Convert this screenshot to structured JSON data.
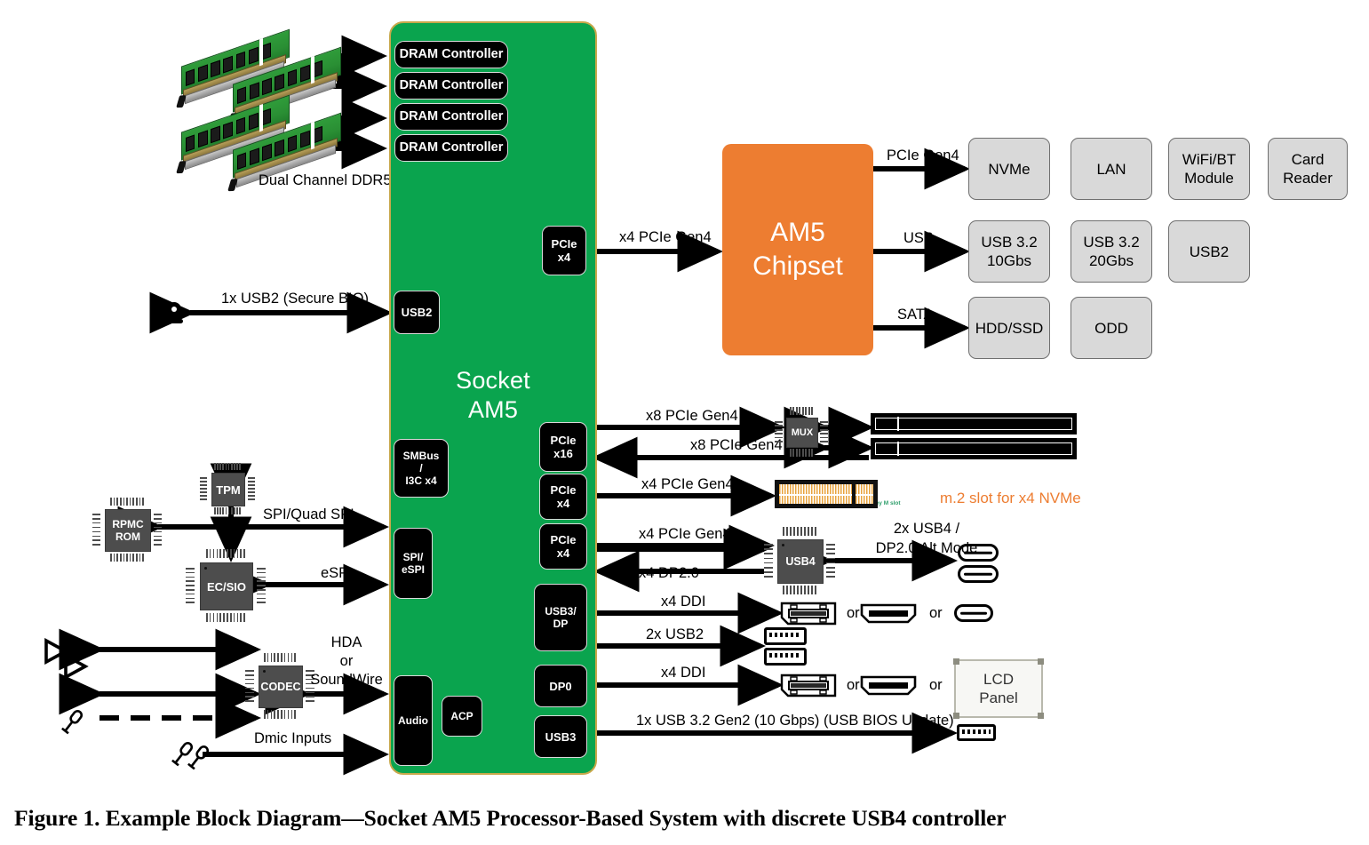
{
  "figure": {
    "caption": "Figure 1. Example Block Diagram—Socket AM5 Processor-Based System with discrete USB4 controller"
  },
  "colors": {
    "socket_green": "#0AA44E",
    "chipset_orange": "#ED7D31",
    "peripheral_grey": "#D9D9D9",
    "block_black": "#000000",
    "chip_grey": "#4D4D4D",
    "keym_green": "#2E9E6B"
  },
  "socket": {
    "title_line1": "Socket",
    "title_line2": "AM5",
    "dram_controllers": [
      {
        "label": "DRAM Controller"
      },
      {
        "label": "DRAM Controller"
      },
      {
        "label": "DRAM Controller"
      },
      {
        "label": "DRAM Controller"
      }
    ],
    "left_blocks": [
      {
        "name": "usb2",
        "label": "USB2"
      },
      {
        "name": "smbus",
        "label": "SMBus\n/\nI3C x4",
        "l1": "SMBus",
        "l2": "/",
        "l3": "I3C x4"
      },
      {
        "name": "spi-espi",
        "label": "SPI/\neSPI",
        "l1": "SPI/",
        "l2": "eSPI"
      },
      {
        "name": "audio",
        "label": "Audio"
      },
      {
        "name": "acp",
        "label": "ACP"
      }
    ],
    "right_blocks": [
      {
        "name": "pcie-x4-chipset",
        "l1": "PCIe",
        "l2": "x4"
      },
      {
        "name": "pcie-x16",
        "l1": "PCIe",
        "l2": "x16"
      },
      {
        "name": "pcie-x4-m2",
        "l1": "PCIe",
        "l2": "x4"
      },
      {
        "name": "pcie-x4-usb4",
        "l1": "PCIe",
        "l2": "x4"
      },
      {
        "name": "usb3-dp",
        "l1": "USB3/",
        "l2": "DP"
      },
      {
        "name": "dp0",
        "l1": "DP0",
        "l2": ""
      },
      {
        "name": "usb3",
        "l1": "USB3",
        "l2": ""
      }
    ]
  },
  "memory": {
    "label": "Dual Channel DDR5"
  },
  "chipset": {
    "line1": "AM5",
    "line2": "Chipset",
    "links": [
      {
        "label": "PCIe Gen4"
      },
      {
        "label": "USB"
      },
      {
        "label": "SATA"
      }
    ],
    "uplink_label": "x4 PCIe Gen4",
    "peripherals_row1": [
      {
        "label": "NVMe"
      },
      {
        "label": "LAN"
      },
      {
        "label": "WiFi/BT\nModule",
        "l1": "WiFi/BT",
        "l2": "Module"
      },
      {
        "label": "Card\nReader",
        "l1": "Card",
        "l2": "Reader"
      }
    ],
    "peripherals_row2": [
      {
        "label": "USB 3.2\n10Gbs",
        "l1": "USB 3.2",
        "l2": "10Gbs"
      },
      {
        "label": "USB 3.2\n20Gbs",
        "l1": "USB 3.2",
        "l2": "20Gbs"
      },
      {
        "label": "USB2",
        "l1": "USB2",
        "l2": ""
      }
    ],
    "peripherals_row3": [
      {
        "label": "HDD/SSD"
      },
      {
        "label": "ODD"
      }
    ]
  },
  "left_io": {
    "secure_bio_label": "1x USB2 (Secure BIO)",
    "spi_label": "SPI/Quad SPI",
    "espi_label": "eSPI",
    "hda_l1": "HDA",
    "hda_l2": "or",
    "hda_l3": "SoundWire",
    "dmic_label": "Dmic Inputs",
    "chips": [
      {
        "name": "tpm",
        "label": "TPM"
      },
      {
        "name": "rpmc-rom",
        "l1": "RPMC",
        "l2": "ROM"
      },
      {
        "name": "ec-sio",
        "label": "EC/SIO"
      },
      {
        "name": "codec",
        "label": "CODEC"
      }
    ]
  },
  "right_io": {
    "pcie_x8_a": "x8 PCIe Gen4",
    "pcie_x8_b": "x8 PCIe Gen4",
    "pcie_x4_m2": "x4 PCIe Gen4",
    "pcie_x4_usb4": "x4 PCIe Gen4",
    "dp20": "2x x4 DP2.0",
    "ddi_1": "x4 DDI",
    "usb2_2x": "2x USB2",
    "ddi_2": "x4 DDI",
    "usb3_bios": "1x USB 3.2 Gen2 (10 Gbps) (USB BIOS Update)",
    "usb4_alt_l1": "2x USB4 /",
    "usb4_alt_l2": "DP2.0 Alt Mode",
    "m2_note": "m.2 slot for x4 NVMe",
    "keym_label": "Key M slot",
    "mux_label": "MUX",
    "usb4_label": "USB4",
    "or_label": "or",
    "lcd_l1": "LCD",
    "lcd_l2": "Panel"
  }
}
